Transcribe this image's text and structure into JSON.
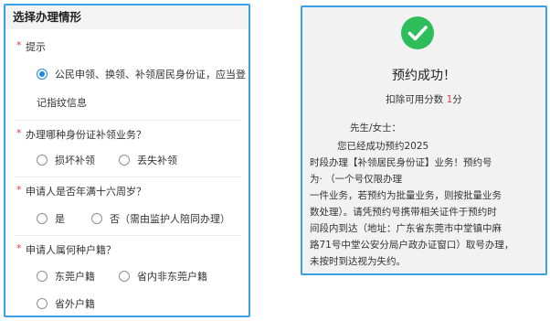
{
  "left": {
    "title": "选择办理情形",
    "questions": [
      {
        "label": "提示",
        "options": [
          {
            "label_line1": "公民申领、换领、补领居民身份证，应当登",
            "label_line2": "记指纹信息",
            "selected": true
          }
        ]
      },
      {
        "label": "办理哪种身份证补领业务？",
        "options": [
          {
            "label": "损坏补领",
            "selected": false
          },
          {
            "label": "丢失补领",
            "selected": false
          }
        ]
      },
      {
        "label": "申请人是否年满十六周岁？",
        "options": [
          {
            "label": "是",
            "selected": false
          },
          {
            "label": "否（需由监护人陪同办理）",
            "selected": false
          }
        ]
      },
      {
        "label": "申请人属何种户籍？",
        "options": [
          {
            "label": "东莞户籍",
            "selected": false
          },
          {
            "label": "省内非东莞户籍",
            "selected": false
          },
          {
            "label": "省外户籍",
            "selected": false
          }
        ]
      }
    ],
    "required_mark": "*"
  },
  "right": {
    "icon": "check-circle-icon",
    "title": "预约成功！",
    "subtitle_prefix": "扣除可用分数 ",
    "subtitle_value": "1",
    "subtitle_suffix": "分",
    "lines": [
      "先生/女士：",
      "您已经成功预约2025",
      "时段办理【补领居民身份证】业务！预约号",
      "为·                              （一个号仅限办理",
      "一件业务，若预约为批量业务，则按批量业务",
      "数处理）。请凭预约号携带相关证件于预约时",
      "间段内到达（地址：广东省东莞市中堂镇中麻",
      "路71号中堂公安分局户政办证窗口）取号办理，",
      "未按时到达视为失约。"
    ]
  },
  "colors": {
    "border": "#3aa0e8",
    "accent_blue": "#1e88e5",
    "required_red": "#e23c3c",
    "success_green": "#2dbd5a"
  }
}
